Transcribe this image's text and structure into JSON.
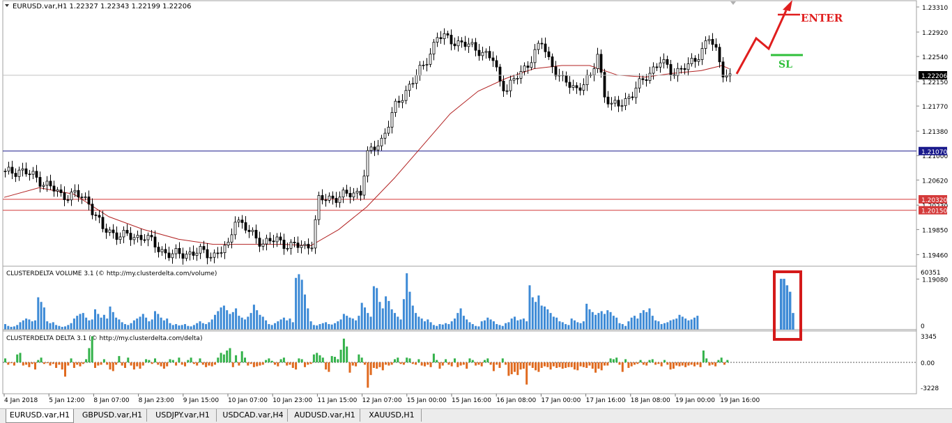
{
  "symbol_info": "EURUSD.var,H1  1.22327 1.22343 1.22199 1.22206",
  "colors": {
    "candle": "#000000",
    "ma": "#b22222",
    "hline_blue": "#1a1a8c",
    "hline_red": "#d43a3a",
    "volume_bar": "#3d8ad6",
    "delta_pos": "#33b24a",
    "delta_neg": "#e06a1f",
    "annot_red": "#e01e1e",
    "annot_green": "#2fbf3a"
  },
  "price_axis": {
    "ticks": [
      "1.23310",
      "1.22920",
      "1.22540",
      "1.22150",
      "1.21770",
      "1.21380",
      "1.21000",
      "1.20620",
      "1.20230",
      "1.19850",
      "1.19460",
      "1.19080"
    ],
    "current_price_label": "1.22206",
    "levels": [
      {
        "value": "1.21070",
        "color": "blue"
      },
      {
        "value": "1.20320",
        "color": "red"
      },
      {
        "value": "1.20150",
        "color": "red"
      }
    ]
  },
  "volume_panel": {
    "title": "CLUSTERDELTA VOLUME 3.1 (© http://my.clusterdelta.com/volume)",
    "axis_max": "60351",
    "axis_min": "0"
  },
  "delta_panel": {
    "title": "CLUSTERDELTA DELTA 3.1 (© http://my.clusterdelta.com/delta)",
    "axis_top": "3345",
    "axis_zero": "0.00",
    "axis_bottom": "-3228"
  },
  "time_axis": [
    "4 Jan 2018",
    "5 Jan 12:00",
    "8 Jan 07:00",
    "8 Jan 23:00",
    "9 Jan 15:00",
    "10 Jan 07:00",
    "10 Jan 23:00",
    "11 Jan 15:00",
    "12 Jan 07:00",
    "15 Jan 00:00",
    "15 Jan 16:00",
    "16 Jan 08:00",
    "17 Jan 00:00",
    "17 Jan 16:00",
    "18 Jan 08:00",
    "19 Jan 00:00",
    "19 Jan 16:00"
  ],
  "annotations": {
    "enter": "ENTER",
    "sl": "SL"
  },
  "tabs": [
    "EURUSD.var,H1",
    "GBPUSD.var,H1",
    "USDJPY.var,H1",
    "USDCAD.var,H4",
    "AUDUSD.var,H1",
    "XAUUSD,H1"
  ],
  "chart_data": [
    {
      "type": "candlestick",
      "title": "EURUSD.var,H1",
      "ylim": [
        1.1908,
        1.2331
      ],
      "x_labels": [
        "4 Jan 2018",
        "5 Jan 12:00",
        "8 Jan 07:00",
        "8 Jan 23:00",
        "9 Jan 15:00",
        "10 Jan 07:00",
        "10 Jan 23:00",
        "11 Jan 15:00",
        "12 Jan 07:00",
        "15 Jan 00:00",
        "15 Jan 16:00",
        "16 Jan 08:00",
        "17 Jan 00:00",
        "17 Jan 16:00",
        "18 Jan 08:00",
        "19 Jan 00:00",
        "19 Jan 16:00"
      ],
      "close_path": [
        [
          0,
          1.2072
        ],
        [
          4,
          1.2078
        ],
        [
          8,
          1.2068
        ],
        [
          12,
          1.2055
        ],
        [
          16,
          1.2038
        ],
        [
          20,
          1.204
        ],
        [
          24,
          1.2028
        ],
        [
          28,
          1.1985
        ],
        [
          32,
          1.1978
        ],
        [
          36,
          1.1973
        ],
        [
          40,
          1.1975
        ],
        [
          44,
          1.1955
        ],
        [
          48,
          1.1945
        ],
        [
          52,
          1.1948
        ],
        [
          56,
          1.195
        ],
        [
          60,
          1.1946
        ],
        [
          64,
          1.1958
        ],
        [
          66,
          1.2005
        ],
        [
          70,
          1.198
        ],
        [
          74,
          1.1965
        ],
        [
          78,
          1.1968
        ],
        [
          82,
          1.196
        ],
        [
          86,
          1.1958
        ],
        [
          88,
          1.1965
        ],
        [
          90,
          1.203
        ],
        [
          94,
          1.2035
        ],
        [
          98,
          1.2038
        ],
        [
          102,
          1.2045
        ],
        [
          104,
          1.21
        ],
        [
          108,
          1.2125
        ],
        [
          112,
          1.2175
        ],
        [
          116,
          1.221
        ],
        [
          120,
          1.2238
        ],
        [
          124,
          1.2285
        ],
        [
          128,
          1.228
        ],
        [
          132,
          1.2272
        ],
        [
          136,
          1.2265
        ],
        [
          140,
          1.2248
        ],
        [
          142,
          1.2215
        ],
        [
          144,
          1.2205
        ],
        [
          148,
          1.2228
        ],
        [
          152,
          1.226
        ],
        [
          154,
          1.2275
        ],
        [
          156,
          1.225
        ],
        [
          160,
          1.2215
        ],
        [
          164,
          1.2205
        ],
        [
          168,
          1.222
        ],
        [
          170,
          1.226
        ],
        [
          172,
          1.2195
        ],
        [
          174,
          1.2175
        ],
        [
          176,
          1.218
        ],
        [
          180,
          1.2195
        ],
        [
          184,
          1.2225
        ],
        [
          188,
          1.2245
        ],
        [
          192,
          1.223
        ],
        [
          196,
          1.2238
        ],
        [
          200,
          1.2265
        ],
        [
          202,
          1.2282
        ],
        [
          204,
          1.2262
        ],
        [
          206,
          1.2232
        ],
        [
          208,
          1.222
        ]
      ],
      "moving_average": [
        [
          0,
          1.2035
        ],
        [
          10,
          1.205
        ],
        [
          20,
          1.204
        ],
        [
          30,
          1.2005
        ],
        [
          40,
          1.1985
        ],
        [
          50,
          1.197
        ],
        [
          60,
          1.1962
        ],
        [
          70,
          1.1962
        ],
        [
          80,
          1.1962
        ],
        [
          88,
          1.196
        ],
        [
          96,
          1.1985
        ],
        [
          104,
          1.202
        ],
        [
          112,
          1.2065
        ],
        [
          120,
          1.2115
        ],
        [
          128,
          1.2165
        ],
        [
          136,
          1.22
        ],
        [
          144,
          1.222
        ],
        [
          152,
          1.2235
        ],
        [
          160,
          1.224
        ],
        [
          168,
          1.224
        ],
        [
          176,
          1.2225
        ],
        [
          184,
          1.2222
        ],
        [
          192,
          1.2228
        ],
        [
          200,
          1.2232
        ],
        [
          206,
          1.224
        ],
        [
          208,
          1.2235
        ]
      ],
      "horizontal_levels": [
        1.2107,
        1.2032,
        1.2015
      ],
      "last_price": 1.22206,
      "last_bar_ohlc": {
        "open": 1.22327,
        "high": 1.22343,
        "low": 1.22199,
        "close": 1.22206
      }
    },
    {
      "type": "bar",
      "title": "CLUSTERDELTA VOLUME 3.1 (© http://my.clusterdelta.com/volume)",
      "ylim": [
        0,
        60351
      ],
      "values": [
        6000,
        4000,
        3000,
        3500,
        5000,
        8000,
        10000,
        12000,
        11000,
        9000,
        10000,
        35000,
        30000,
        24000,
        9000,
        7000,
        8000,
        5000,
        4000,
        3000,
        3500,
        5000,
        7000,
        12000,
        15000,
        17000,
        18000,
        13000,
        10000,
        11000,
        22000,
        17000,
        13000,
        16000,
        12000,
        25000,
        19000,
        13000,
        11000,
        8000,
        6000,
        5000,
        7000,
        10000,
        12000,
        14000,
        17000,
        13000,
        9000,
        11000,
        20000,
        17000,
        13000,
        10000,
        12000,
        7000,
        5000,
        6000,
        4500,
        5000,
        6000,
        4000,
        3500,
        5000,
        7000,
        9000,
        7000,
        6000,
        8000,
        11000,
        16000,
        20000,
        24000,
        26000,
        21000,
        17000,
        19000,
        23000,
        15000,
        13000,
        11000,
        14000,
        18000,
        27000,
        21000,
        16000,
        14000,
        10000,
        6000,
        5000,
        7000,
        9000,
        11000,
        13000,
        10000,
        12000,
        8000,
        56000,
        60000,
        54000,
        38000,
        23000,
        9000,
        5000,
        4500,
        6000,
        7000,
        8000,
        6000,
        5500,
        7000,
        9000,
        11000,
        17000,
        15000,
        13000,
        12000,
        10000,
        15000,
        29000,
        24000,
        18000,
        14000,
        47000,
        45000,
        30000,
        23000,
        36000,
        31000,
        22000,
        18000,
        14000,
        11000,
        33000,
        61000,
        41000,
        26000,
        18000,
        14000,
        12000,
        9000,
        11000,
        8000,
        5000,
        4000,
        6000,
        5500,
        7000,
        6000,
        9000,
        12000,
        18000,
        23000,
        15000,
        11000,
        8000,
        6000,
        4000,
        3500,
        9000,
        10000,
        13000,
        11000,
        9000,
        6000,
        5000,
        4000,
        7000,
        8000,
        12000,
        14000,
        10000,
        11000,
        12000,
        9000,
        48000,
        35000,
        30000,
        37000,
        26000,
        25000,
        22000,
        18000,
        14000,
        13000,
        9000,
        8000,
        6000,
        5000,
        12000,
        10000,
        8000,
        7000,
        9000,
        28000,
        22000,
        19000,
        16000,
        18000,
        20000,
        17000,
        21000,
        19000,
        15000,
        13000,
        7000,
        6000,
        4000,
        9000,
        13000,
        15000,
        12000,
        18000,
        21000,
        19000,
        23000,
        15000,
        10000,
        9000,
        6000,
        7000,
        8000,
        10000,
        11000,
        12000,
        16000,
        14000,
        12000,
        10000,
        11000,
        13000,
        15000
      ],
      "highlighted_bars": [
        55000,
        55000,
        48000,
        41000,
        18000
      ]
    },
    {
      "type": "bar",
      "title": "CLUSTERDELTA DELTA 3.1 (© http://my.clusterdelta.com/delta)",
      "ylim": [
        -3228,
        3345
      ],
      "values": [
        500,
        -300,
        -100,
        -400,
        1000,
        1200,
        -400,
        -300,
        -600,
        -200,
        -900,
        300,
        600,
        -200,
        -100,
        -400,
        -200,
        -700,
        -300,
        -900,
        -1800,
        -400,
        500,
        -700,
        -300,
        -500,
        -200,
        400,
        1800,
        3300,
        -700,
        -400,
        -300,
        400,
        -300,
        -900,
        -1100,
        -300,
        800,
        -400,
        -700,
        600,
        -400,
        -900,
        -500,
        -800,
        -400,
        400,
        300,
        -200,
        500,
        -300,
        -500,
        -800,
        -500,
        400,
        300,
        -400,
        600,
        -300,
        -500,
        300,
        600,
        -200,
        -400,
        500,
        -300,
        -600,
        -400,
        -500,
        -300,
        600,
        1200,
        1000,
        1500,
        1800,
        -600,
        900,
        -400,
        1400,
        600,
        -400,
        -200,
        -600,
        -500,
        -400,
        -300,
        300,
        500,
        200,
        -300,
        -500,
        400,
        600,
        -400,
        -300,
        -700,
        -900,
        500,
        400,
        -600,
        -300,
        -200,
        1000,
        1200,
        900,
        600,
        -900,
        -1200,
        800,
        700,
        400,
        1600,
        3000,
        2000,
        -1300,
        -400,
        -500,
        1000,
        600,
        -300,
        -3200,
        -1600,
        -700,
        -800,
        -600,
        -1000,
        -300,
        -400,
        -300,
        400,
        600,
        -200,
        -300,
        600,
        500,
        -200,
        -300,
        400,
        -400,
        -500,
        -300,
        -600,
        1100,
        300,
        -800,
        -400,
        400,
        -300,
        -500,
        500,
        -600,
        -400,
        -300,
        -800,
        500,
        300,
        -400,
        -300,
        -500,
        300,
        500,
        -300,
        -1100,
        -300,
        -700,
        500,
        -300,
        -1700,
        -1500,
        -1200,
        -1600,
        -900,
        -800,
        -2800,
        -400,
        -700,
        -1000,
        -1200,
        -700,
        -500,
        -600,
        -900,
        -500,
        -700,
        -600,
        -800,
        -700,
        -600,
        -600,
        -900,
        -1000,
        -500,
        -600,
        -700,
        -400,
        -800,
        -1300,
        -800,
        -1000,
        -400,
        -400,
        500,
        400,
        600,
        -300,
        -1200,
        400,
        -700,
        -500,
        -300,
        -200,
        300,
        -300,
        -400,
        300,
        400,
        -300,
        -200,
        -500,
        300,
        -300,
        -900,
        -800,
        -400,
        -500,
        -400,
        -600,
        -400,
        -300,
        -500,
        -300,
        -600,
        1500,
        500,
        -400,
        -300,
        -500,
        300,
        600,
        -300,
        300
      ]
    }
  ]
}
